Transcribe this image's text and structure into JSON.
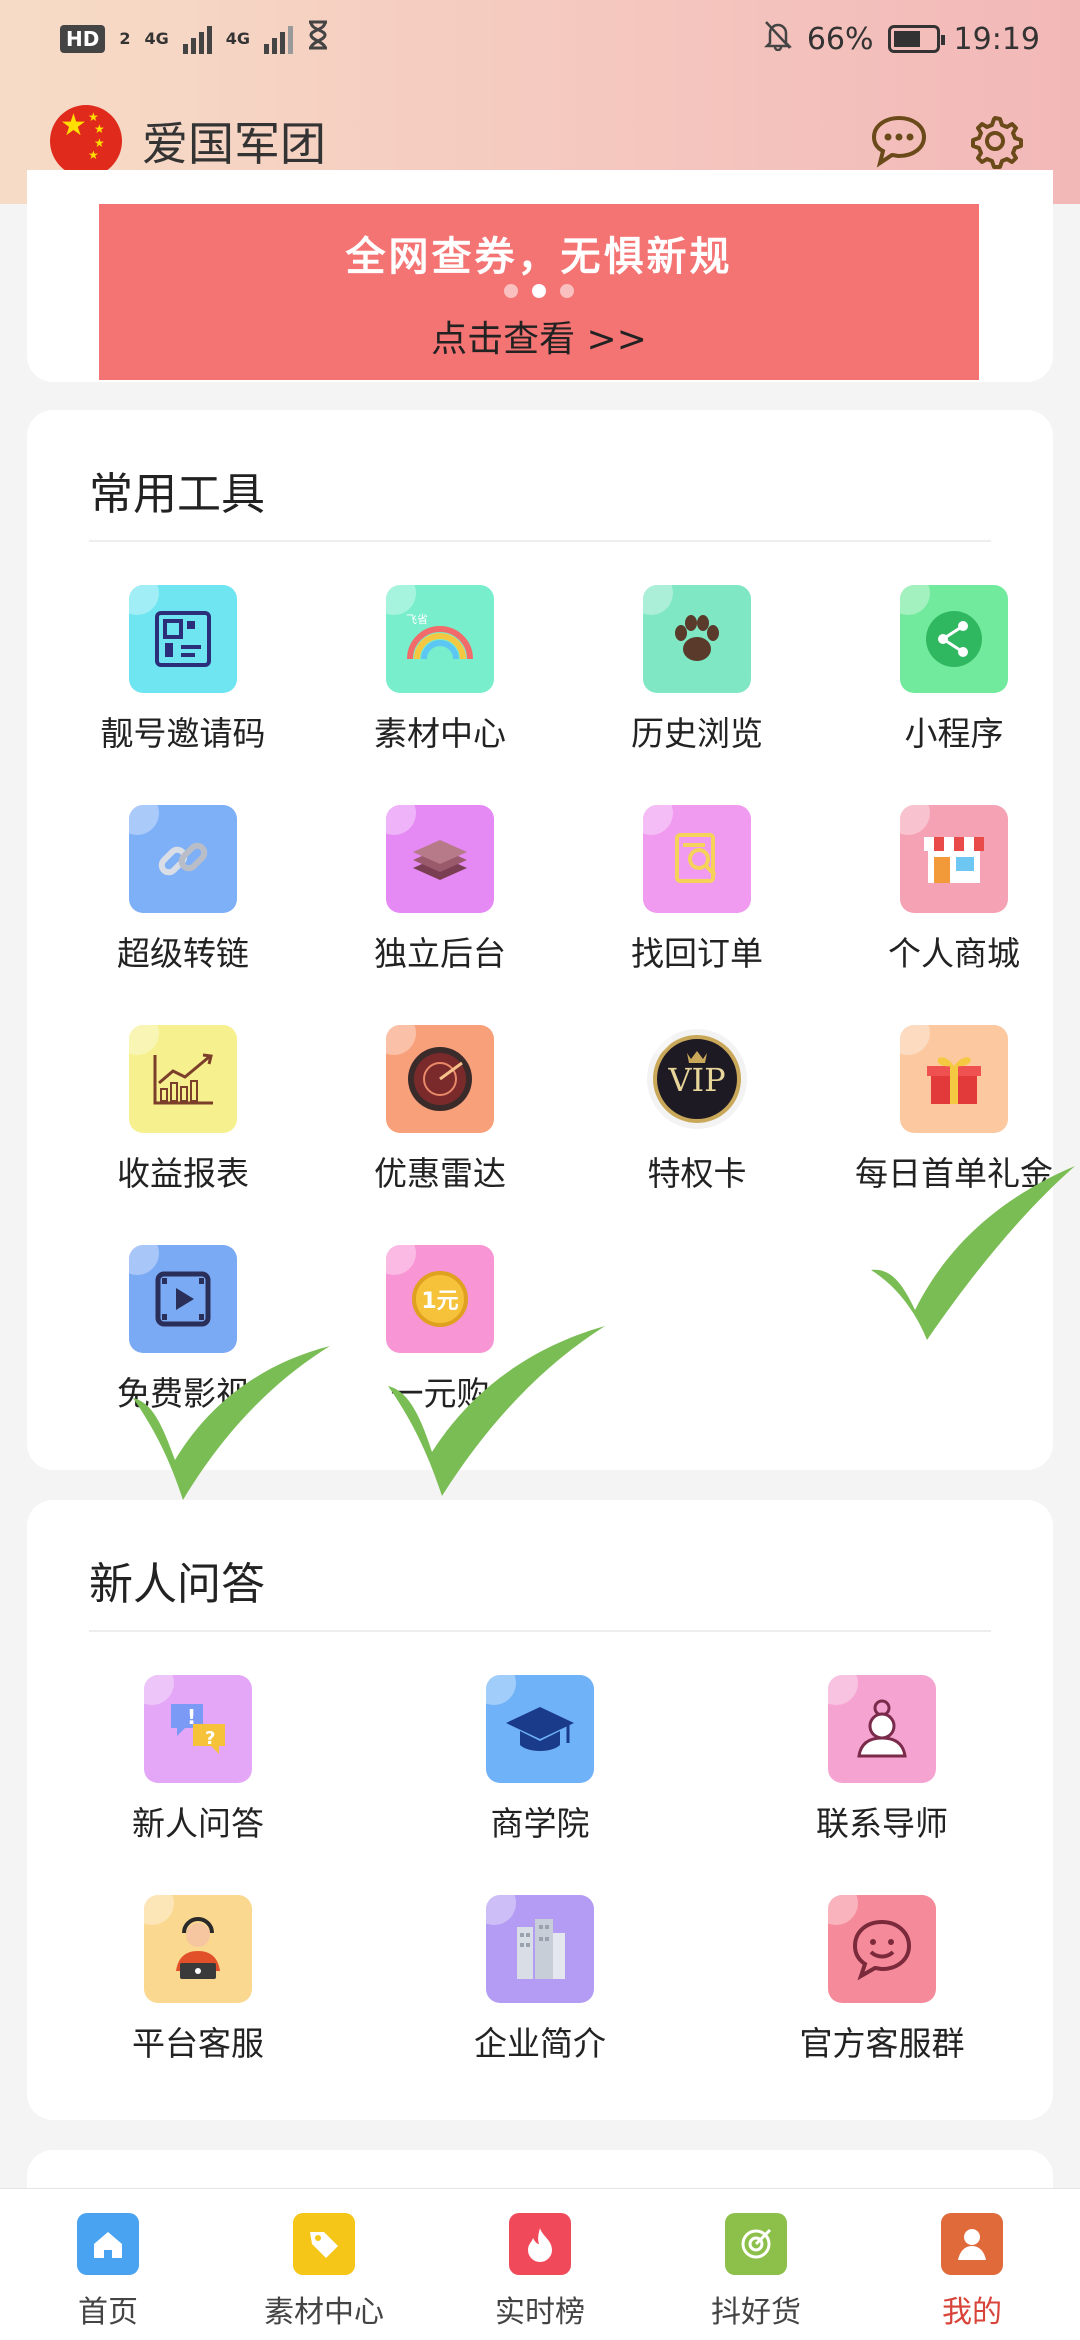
{
  "status_bar": {
    "hd_badge": "HD",
    "sim": "2",
    "net1": "4G",
    "net2": "4G",
    "battery": "66%",
    "battery_level": 0.66,
    "time": "19:19"
  },
  "header": {
    "title": "爱国军团"
  },
  "banner": {
    "title": "全网查券，无惧新规",
    "subtitle": "点击查看 >>"
  },
  "tools": {
    "title": "常用工具",
    "items": [
      {
        "label": "靓号邀请码",
        "icon": "qr-code-icon",
        "color": "#6fe5f2"
      },
      {
        "label": "素材中心",
        "icon": "rainbow-icon",
        "color": "#78eecd"
      },
      {
        "label": "历史浏览",
        "icon": "paw-icon",
        "color": "#7fe7c4"
      },
      {
        "label": "小程序",
        "icon": "share-icon",
        "color": "#72ea9d"
      },
      {
        "label": "超级转链",
        "icon": "link-icon",
        "color": "#7db0f7"
      },
      {
        "label": "独立后台",
        "icon": "layers-icon",
        "color": "#e58af5"
      },
      {
        "label": "找回订单",
        "icon": "order-search-icon",
        "color": "#f09af0"
      },
      {
        "label": "个人商城",
        "icon": "shop-icon",
        "color": "#f5a2b4"
      },
      {
        "label": "收益报表",
        "icon": "report-chart-icon",
        "color": "#f6f08e"
      },
      {
        "label": "优惠雷达",
        "icon": "radar-icon",
        "color": "#f7a07a"
      },
      {
        "label": "特权卡",
        "icon": "vip-icon",
        "color": "#2a2230"
      },
      {
        "label": "每日首单礼金",
        "icon": "gift-icon",
        "color": "#fbc8a0"
      },
      {
        "label": "免费影视",
        "icon": "video-icon",
        "color": "#7aaaf4"
      },
      {
        "label": "一元购",
        "icon": "one-yuan-icon",
        "color": "#f795d5"
      }
    ]
  },
  "qa": {
    "title": "新人问答",
    "items": [
      {
        "label": "新人问答",
        "icon": "chat-question-icon",
        "color": "#e4a6f6"
      },
      {
        "label": "商学院",
        "icon": "graduation-cap-icon",
        "color": "#6fb2f8"
      },
      {
        "label": "联系导师",
        "icon": "mentor-icon",
        "color": "#f5a4d2"
      },
      {
        "label": "平台客服",
        "icon": "customer-service-icon",
        "color": "#fbd890"
      },
      {
        "label": "企业简介",
        "icon": "building-icon",
        "color": "#b49cf4"
      },
      {
        "label": "官方客服群",
        "icon": "smile-icon",
        "color": "#f58a9a"
      }
    ]
  },
  "bottom_nav": {
    "items": [
      {
        "label": "首页",
        "icon": "home-icon",
        "color": "#4aa3f0"
      },
      {
        "label": "素材中心",
        "icon": "tag-icon",
        "color": "#f5c518"
      },
      {
        "label": "实时榜",
        "icon": "fire-icon",
        "color": "#f04a5a"
      },
      {
        "label": "抖好货",
        "icon": "target-icon",
        "color": "#8cc04a"
      },
      {
        "label": "我的",
        "icon": "profile-icon",
        "color": "#e06a3a"
      }
    ],
    "active_index": 4
  }
}
